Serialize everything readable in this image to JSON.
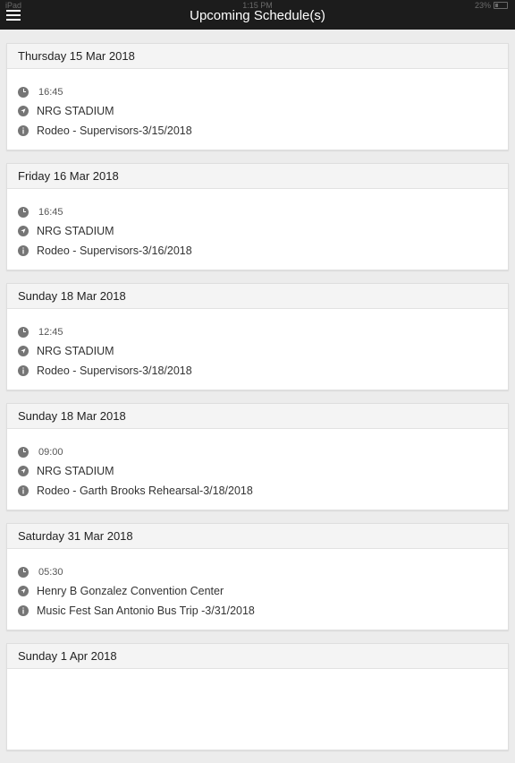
{
  "status_bar": {
    "carrier": "iPad",
    "time": "1:15 PM",
    "battery": "23%"
  },
  "header": {
    "title": "Upcoming Schedule(s)",
    "menu_icon": "hamburger-menu-icon"
  },
  "schedules": [
    {
      "date": "Thursday 15 Mar 2018",
      "time": "16:45",
      "location": "NRG STADIUM",
      "description": "Rodeo - Supervisors-3/15/2018"
    },
    {
      "date": "Friday 16 Mar 2018",
      "time": "16:45",
      "location": "NRG STADIUM",
      "description": "Rodeo - Supervisors-3/16/2018"
    },
    {
      "date": "Sunday 18 Mar 2018",
      "time": "12:45",
      "location": "NRG STADIUM",
      "description": "Rodeo - Supervisors-3/18/2018"
    },
    {
      "date": "Sunday 18 Mar 2018",
      "time": "09:00",
      "location": "NRG STADIUM",
      "description": "Rodeo - Garth Brooks Rehearsal-3/18/2018"
    },
    {
      "date": "Saturday 31 Mar 2018",
      "time": "05:30",
      "location": "Henry B Gonzalez Convention Center",
      "description": "Music Fest San Antonio Bus Trip -3/31/2018"
    },
    {
      "date": "Sunday 1 Apr 2018"
    }
  ],
  "icons": {
    "time": "clock-icon",
    "location": "navigation-arrow-icon",
    "description": "info-icon"
  }
}
